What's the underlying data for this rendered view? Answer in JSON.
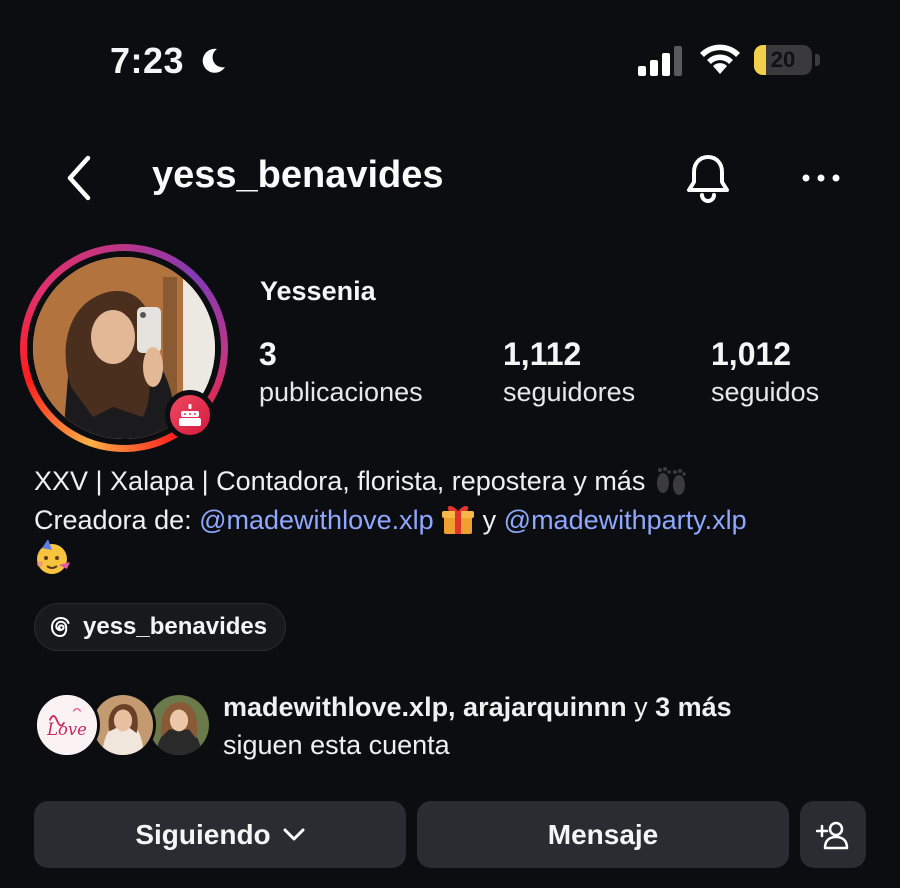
{
  "status_bar": {
    "time": "7:23",
    "battery_level": "20",
    "battery_fraction": 0.2,
    "icons": [
      "moon-icon",
      "signal-icon",
      "wifi-icon",
      "battery-icon"
    ],
    "battery_color": "#f2d04b"
  },
  "header": {
    "username": "yess_benavides",
    "icons": [
      "back-chevron-icon",
      "bell-icon",
      "more-icon"
    ]
  },
  "profile": {
    "display_name": "Yessenia",
    "story_ring_colors": [
      "#fcb045",
      "#fd1d1d",
      "#e1306c",
      "#c13584",
      "#833ab4"
    ],
    "badge_icon": "birthday-cake-icon",
    "stats": {
      "posts": {
        "value": "3",
        "label": "publicaciones"
      },
      "followers": {
        "value": "1,112",
        "label": "seguidores"
      },
      "following": {
        "value": "1,012",
        "label": "seguidos"
      }
    }
  },
  "bio": {
    "line1": "XXV | Xalapa | Contadora, florista, repostera y más",
    "line1_emoji": "footprints-emoji",
    "line2_prefix": "Creadora de: ",
    "mention1": "@madewithlove.xlp",
    "gift_emoji": "gift-emoji",
    "connector": " y ",
    "mention2": "@madewithparty.xlp",
    "line3_emoji": "party-face-emoji",
    "mention_color": "#8fa8ff"
  },
  "threads_chip": {
    "icon": "threads-icon",
    "label": "yess_benavides"
  },
  "followed_by": {
    "names": "madewithlove.xlp, arajarquinnn",
    "connector": " y ",
    "more": "3 más",
    "suffix": "siguen esta cuenta"
  },
  "actions": {
    "following_label": "Siguiendo",
    "message_label": "Mensaje",
    "following_icon": "chevron-down-icon",
    "add_icon": "add-person-icon"
  }
}
